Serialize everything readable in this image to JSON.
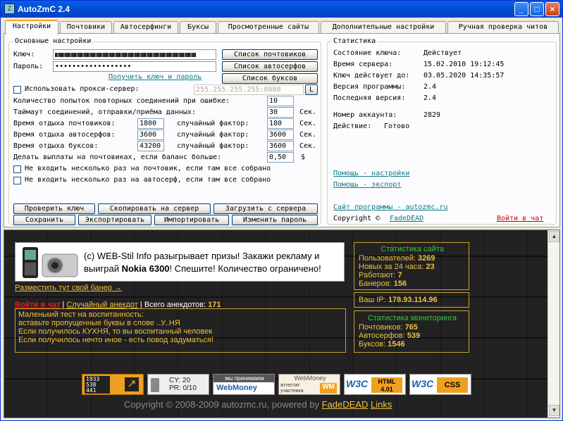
{
  "window": {
    "title": "AutoZmC 2.4",
    "min": "_",
    "max": "□",
    "close": "×"
  },
  "tabs": [
    "Настройки",
    "Почтовики",
    "Автосерфинги",
    "Буксы",
    "Просмотренные сайты",
    "Дополнительные настройки",
    "Ручная проверка читов"
  ],
  "basic": {
    "title": "Основные настройки",
    "key_label": "Ключ:",
    "pass_label": "Пароль:",
    "pass_value": "••••••••••••••••••",
    "get_key_link": "Получить ключ и пароль",
    "btn_mail": "Список почтовиков",
    "btn_surf": "Список автосерфов",
    "btn_bux": "Список буксов",
    "proxy_label": "Использовать прокси-сервер:",
    "proxy_value": "255.255.255.255:8080",
    "proxy_btn": "L",
    "retries_label": "Количество попыток повторных соединений при ошибке:",
    "retries_value": "10",
    "timeout_label": "Таймаут соединений, отправки/приёма данных:",
    "timeout_value": "30",
    "sec": "Сек.",
    "mail_rest_label": "Время отдыха почтовиков:",
    "mail_rest": "1800",
    "surf_rest_label": "Время отдыха автосерфов:",
    "surf_rest": "3600",
    "bux_rest_label": "Время отдыха буксов:",
    "bux_rest": "43200",
    "random_label": "случайный фактор:",
    "mail_rand": "180",
    "surf_rand": "3600",
    "bux_rand": "3600",
    "payout_label": "Делать выплаты на почтовиках, если баланс больше:",
    "payout_value": "0,50",
    "dollar": "$",
    "no_repeat_mail": "Не входить несколько раз на почтовик, если там все собрано",
    "no_repeat_surf": "Не входить несколько раз на автосерф, если там все собрано",
    "btn_check": "Проверить ключ",
    "btn_copy": "Скопировать на сервер",
    "btn_load": "Загрузить с сервера",
    "btn_save": "Сохранить",
    "btn_export": "Экспортировать",
    "btn_import": "Импортировать",
    "btn_changepass": "Изменить пароль"
  },
  "stats": {
    "title": "Статистика",
    "key_state_label": "Состояние ключа:",
    "key_state": "Действует",
    "server_time_label": "Время сервера:",
    "server_time": "15.02.2010 19:12:45",
    "key_until_label": "Ключ действует до:",
    "key_until": "03.05.2020 14:35:57",
    "prog_ver_label": "Версия программы:",
    "prog_ver": "2.4",
    "last_ver_label": "Последняя версия:",
    "last_ver": "2.4",
    "account_label": "Номер аккаунта:",
    "account": "2829",
    "action_label": "Действие:",
    "action": "Готово",
    "help_settings": "Помощь - настройки",
    "help_export": "Помощь - экспорт",
    "site": "Сайт программы - autozmc.ru",
    "copyright": "Copyright ©",
    "author": "FadeDEAD",
    "chat": "Войти в чат"
  },
  "web": {
    "banner_text_1": "(c) WEB-Stil Info разыгрывает призы! Закажи рекламу и выиграй ",
    "banner_bold": "Nokia 6300",
    "banner_text_2": "! Спешите! Количество ограничено!",
    "place_banner": "Разместить тут свой банер →",
    "nav_chat": "Войти в чат",
    "sep": "|",
    "nav_random": "Случайный анекдот",
    "nav_total_label": "Всего анекдотов:",
    "nav_total": "171",
    "joke": [
      "Маленький тест на воспитанность:",
      "вставьте пропущенные буквы в слове ..У..НЯ",
      "Если получилось КУХНЯ, то вы воспитанный человек",
      "Если получилось нечто иное - есть повод задуматься!"
    ],
    "site_stats_title": "Статистика сайта",
    "users_label": "Пользователей:",
    "users": "3269",
    "new24_label": "Новых за 24 часа:",
    "new24": "23",
    "working_label": "Работают:",
    "working": "7",
    "banners_label": "Банеров:",
    "banners": "156",
    "ip_label": "Ваш IP:",
    "ip": "178.93.114.96",
    "mon_title": "Статистика мониторинга",
    "mon_mail_label": "Почтовиков:",
    "mon_mail": "765",
    "mon_surf_label": "Автосерфов:",
    "mon_surf": "539",
    "mon_bux_label": "Буксов:",
    "mon_bux": "1546",
    "counter": [
      "1933",
      "538",
      "441"
    ],
    "cy": "CY: 20",
    "pr": "PR: 0/10",
    "wm1_top": "мы принимаем",
    "wm1": "WebMoney",
    "wm2_top": "WebMoney",
    "wm2": "аттестат участника",
    "w3c_html": "HTML 4.01",
    "w3c_css": "CSS",
    "w3c": "W3C",
    "footer": "Copyright © 2008-2009 autozmc.ru, powered by",
    "footer_author": "FadeDEAD",
    "footer_links": "Links"
  },
  "colors": {
    "accent": "#f5a623",
    "title": "#0450d4",
    "link": "#0a7a8a",
    "gold": "#f0c040",
    "green": "#40c040"
  }
}
